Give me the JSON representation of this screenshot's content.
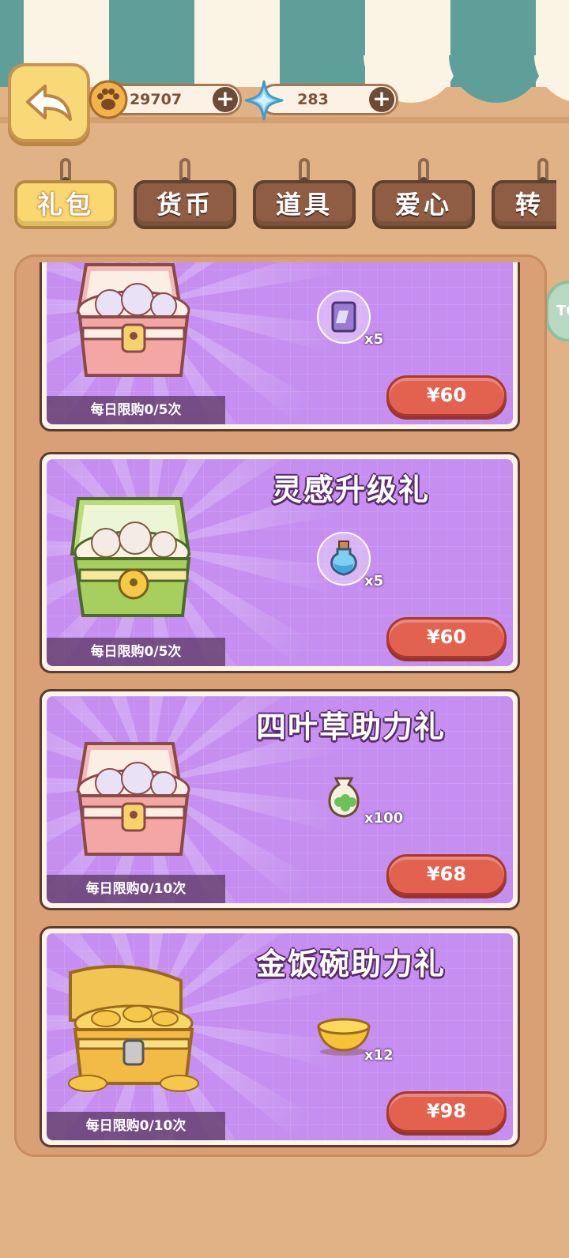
{
  "header": {
    "paw_amount": "29707",
    "gem_amount": "283"
  },
  "tabs": [
    {
      "label": "礼包",
      "active": true
    },
    {
      "label": "货币",
      "active": false
    },
    {
      "label": "道具",
      "active": false
    },
    {
      "label": "爱心",
      "active": false
    },
    {
      "label": "转",
      "active": false
    }
  ],
  "side_badge": "TC",
  "packs": [
    {
      "title": "",
      "item_icon": "book-bubble-icon",
      "qty": "x5",
      "price": "¥60",
      "limit": "每日限购0/5次",
      "chest": "pink-chest"
    },
    {
      "title": "灵感升级礼",
      "item_icon": "potion-bubble-icon",
      "qty": "x5",
      "price": "¥60",
      "limit": "每日限购0/5次",
      "chest": "green-chest"
    },
    {
      "title": "四叶草助力礼",
      "item_icon": "clover-bag-icon",
      "qty": "x100",
      "price": "¥68",
      "limit": "每日限购0/10次",
      "chest": "pink-chest"
    },
    {
      "title": "金饭碗助力礼",
      "item_icon": "gold-bowl-icon",
      "qty": "x12",
      "price": "¥98",
      "limit": "每日限购0/10次",
      "chest": "gold-chest"
    }
  ],
  "colors": {
    "background": "#e2b287",
    "card_purple": "#c58ef0",
    "buy_button": "#e3624f",
    "tab_active": "#fbd771",
    "tab_inactive": "#8e5d43"
  }
}
